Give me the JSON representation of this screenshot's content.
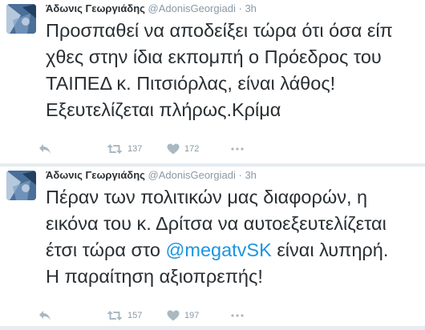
{
  "tweets": [
    {
      "author_name": "Άδωνις Γεωργιάδης",
      "handle": "@AdonisGeorgiadi",
      "dot": "·",
      "time": "3h",
      "lines": [
        "Προσπαθεί να αποδείξει τώρα ότι όσα είπ",
        "χθες στην ίδια εκπομπή ο Πρόεδρος του",
        "ΤΑΙΠΕΔ κ. Πιτσιόρλας, είναι λάθος!",
        "Εξευτελίζεται πλήρως.Κρίμα"
      ],
      "retweets": "137",
      "likes": "172",
      "icons": {
        "reply": "reply-icon",
        "retweet": "retweet-icon",
        "like": "heart-icon",
        "more": "more-dots-icon"
      }
    },
    {
      "author_name": "Άδωνις Γεωργιάδης",
      "handle": "@AdonisGeorgiadi",
      "dot": "·",
      "time": "3h",
      "lines": [
        "Πέραν των πολιτικών μας διαφορών, η",
        "εικόνα του κ. Δρίτσα να αυτοεξευτελίζεται",
        "έτσι τώρα στο ",
        "Η παραίτηση αξιοπρεπής!"
      ],
      "mention": "@megatvSK",
      "line3_after": " είναι λυπηρή.",
      "retweets": "157",
      "likes": "197",
      "icons": {
        "reply": "reply-icon",
        "retweet": "retweet-icon",
        "like": "heart-icon",
        "more": "more-dots-icon"
      }
    }
  ],
  "colors": {
    "text": "#292f33",
    "muted": "#8899a6",
    "icon": "#aab8c2",
    "link": "#1b95e0",
    "divider": "#e6ecf0"
  }
}
